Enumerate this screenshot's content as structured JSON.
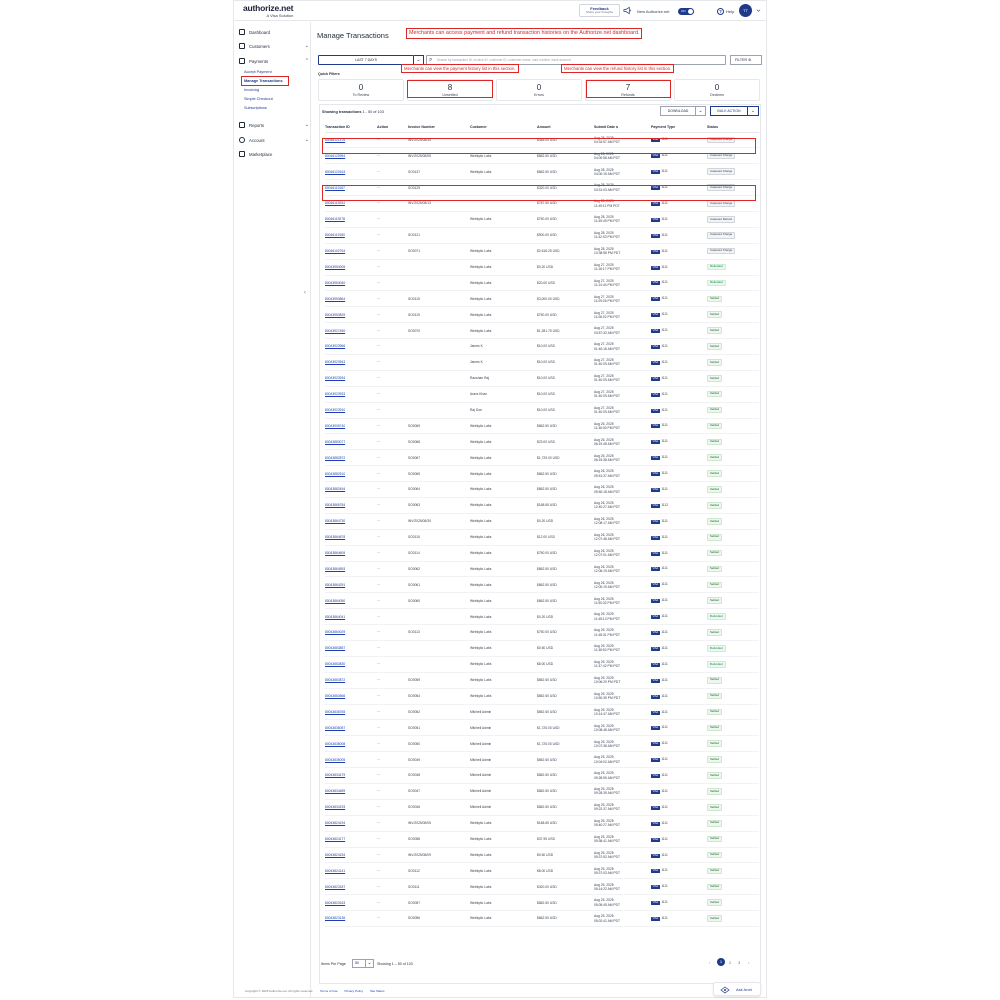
{
  "header": {
    "logo": "authorize.net",
    "logo_sub": "A Visa Solution",
    "feedback_title": "Feedback",
    "feedback_sub": "Share your thoughts",
    "new_auth_label": "New Authorize.net",
    "toggle_label": "ON",
    "help_label": "Help",
    "avatar_initials": "TT"
  },
  "sidebar": {
    "items": [
      {
        "label": "Dashboard",
        "icon": "home-icon"
      },
      {
        "label": "Customers",
        "icon": "customers-icon"
      },
      {
        "label": "Payments",
        "icon": "payments-icon"
      },
      {
        "label": "Reports",
        "icon": "reports-icon"
      },
      {
        "label": "Account",
        "icon": "gear-icon"
      },
      {
        "label": "Marketplace",
        "icon": "bag-icon"
      }
    ],
    "payments_sub": [
      "Accept Payment",
      "Manage Transactions",
      "Invoicing",
      "Simple Checkout",
      "Subscriptions"
    ]
  },
  "main": {
    "title": "Manage Transactions",
    "annotation_top": "Merchants can access payment and refund transaction histories on the Authorize.net dashboard.",
    "annotation_payment": "Merchants can view the payment history list in this section.",
    "annotation_refund": "Merchants can view the refund history list in this section.",
    "date_range": "LAST 7 DAYS",
    "search_placeholder": "Search by transaction ID, invoice ID, customer ID, customer name, card number, bank account",
    "filter_label": "FILTER",
    "quick_filters_label": "Quick Filters",
    "quick_filters": [
      {
        "count": "0",
        "label": "To Review"
      },
      {
        "count": "8",
        "label": "Unsettled"
      },
      {
        "count": "0",
        "label": "Errors"
      },
      {
        "count": "7",
        "label": "Refunds"
      },
      {
        "count": "0",
        "label": "Declines"
      }
    ],
    "showing_label": "Showing transactions",
    "showing_range": "1 - 50 of 103",
    "download_label": "DOWNLOAD",
    "bulk_action_label": "BULK ACTION"
  },
  "table": {
    "columns": [
      "Transaction ID",
      "Action",
      "Invoice Number",
      "Customer",
      "Amount",
      "Submit Date",
      "Payment Type",
      "Status"
    ],
    "rows": [
      {
        "id": "80046121476",
        "action": "···",
        "invoice": "INV/2025/08/34",
        "customer": "",
        "amount": "$448.00 USD",
        "date1": "Aug 28, 2025",
        "date2": "04:34:57 AM PDT",
        "card": "1111",
        "status": "Captured Charge"
      },
      {
        "id": "80046120954",
        "action": "···",
        "invoice": "INV/2025/08/05",
        "customer": "Webkytic Labs",
        "amount": "$862.50 USD",
        "date1": "Aug 28, 2025",
        "date2": "04:00:58 AM PDT",
        "card": "1111",
        "status": "Captured Charge"
      },
      {
        "id": "80046120163",
        "action": "···",
        "invoice": "SO0137",
        "customer": "Webkytic Labs",
        "amount": "$862.50 USD",
        "date1": "Aug 28, 2025",
        "date2": "04:00:15 AM PDT",
        "card": "1111",
        "status": "Captured Charge"
      },
      {
        "id": "80046119187",
        "action": "···",
        "invoice": "SO0129",
        "customer": "",
        "amount": "$320.00 USD",
        "date1": "Aug 28, 2025",
        "date2": "03:31:03 AM PDT",
        "card": "1111",
        "status": "Captured Charge"
      },
      {
        "id": "80046119254",
        "action": "···",
        "invoice": "INV/2025/08/13",
        "customer": "",
        "amount": "$787.50 USD",
        "date1": "Aug 28, 2025",
        "date2": "11:49:11 PM PDT",
        "card": "1111",
        "status": "Captured Charge"
      },
      {
        "id": "80046119278",
        "action": "···",
        "invoice": "",
        "customer": "Webkytic Labs",
        "amount": "$750.00 USD",
        "date1": "Aug 28, 2025",
        "date2": "11:45:49 PM PDT",
        "card": "1111",
        "status": "Captured Refund"
      },
      {
        "id": "80046119180",
        "action": "···",
        "invoice": "SO0121",
        "customer": "",
        "amount": "$900.00 USD",
        "date1": "Aug 28, 2025",
        "date2": "11:42:03 PM PDT",
        "card": "1111",
        "status": "Captured Charge"
      },
      {
        "id": "80046102764",
        "action": "···",
        "invoice": "SO0071",
        "customer": "Webkytic Labs",
        "amount": "$2,616.25 USD",
        "date1": "Aug 28, 2025",
        "date2": "10:38:58 PM PDT",
        "card": "1111",
        "status": "Captured Charge"
      },
      {
        "id": "80043954005",
        "action": "···",
        "invoice": "",
        "customer": "Webkytic Labs",
        "amount": "$0.20 USD",
        "date1": "Aug 27, 2025",
        "date2": "11:16:17 PM PDT",
        "card": "1111",
        "status": "Refunded"
      },
      {
        "id": "80043954040",
        "action": "···",
        "invoice": "",
        "customer": "Webkytic Labs",
        "amount": "$20.00 USD",
        "date1": "Aug 27, 2025",
        "date2": "11:14:44 PM PDT",
        "card": "1111",
        "status": "Refunded"
      },
      {
        "id": "80043953864",
        "action": "···",
        "invoice": "SO0115",
        "customer": "Webkytic Labs",
        "amount": "$3,000.00 USD",
        "date1": "Aug 27, 2025",
        "date2": "11:09:26 PM PDT",
        "card": "1111",
        "status": "Settled"
      },
      {
        "id": "80043953829",
        "action": "···",
        "invoice": "SO0119",
        "customer": "Webkytic Labs",
        "amount": "$750.00 USD",
        "date1": "Aug 27, 2025",
        "date2": "11:08:02 PM PDT",
        "card": "1111",
        "status": "Settled"
      },
      {
        "id": "80043927450",
        "action": "···",
        "invoice": "SO0070",
        "customer": "Webkytic Labs",
        "amount": "$1,281.75 USD",
        "date1": "Aug 27, 2025",
        "date2": "03:57:32 AM PDT",
        "card": "1111",
        "status": "Settled"
      },
      {
        "id": "80043923966",
        "action": "···",
        "invoice": "",
        "customer": "James K",
        "amount": "$10.00 USD",
        "date1": "Aug 27, 2025",
        "date2": "01:40:16 AM PDT",
        "card": "1111",
        "status": "Settled"
      },
      {
        "id": "80043923943",
        "action": "···",
        "invoice": "",
        "customer": "James K",
        "amount": "$10.00 USD",
        "date1": "Aug 27, 2025",
        "date2": "01:40:09 AM PDT",
        "card": "1111",
        "status": "Settled"
      },
      {
        "id": "80043923934",
        "action": "···",
        "invoice": "",
        "customer": "Raushan Raj",
        "amount": "$10.00 USD",
        "date1": "Aug 27, 2025",
        "date2": "01:40:09 AM PDT",
        "card": "1111",
        "status": "Settled"
      },
      {
        "id": "80043923933",
        "action": "···",
        "invoice": "",
        "customer": "Aravs Khan",
        "amount": "$10.00 USD",
        "date1": "Aug 27, 2025",
        "date2": "01:40:09 AM PDT",
        "card": "1111",
        "status": "Settled"
      },
      {
        "id": "80043923910",
        "action": "···",
        "invoice": "",
        "customer": "Raj Doe",
        "amount": "$10.00 USD",
        "date1": "Aug 27, 2025",
        "date2": "01:40:09 AM PDT",
        "card": "1111",
        "status": "Settled"
      },
      {
        "id": "80043905740",
        "action": "···",
        "invoice": "SO0069",
        "customer": "Webkytic Labs",
        "amount": "$862.50 USD",
        "date1": "Aug 26, 2025",
        "date2": "11:36:30 PM PDT",
        "card": "1111",
        "status": "Settled"
      },
      {
        "id": "80043883077",
        "action": "···",
        "invoice": "SO0068",
        "customer": "Webkytic Labs",
        "amount": "$23.00 USD",
        "date1": "Aug 26, 2025",
        "date2": "06:19:48 AM PDT",
        "card": "1111",
        "status": "Settled"
      },
      {
        "id": "80043882872",
        "action": "···",
        "invoice": "SO0067",
        "customer": "Webkytic Labs",
        "amount": "$1,725.00 USD",
        "date1": "Aug 26, 2025",
        "date2": "06:15:38 AM PDT",
        "card": "1111",
        "status": "Settled"
      },
      {
        "id": "80043882510",
        "action": "···",
        "invoice": "SO0065",
        "customer": "Webkytic Labs",
        "amount": "$862.50 USD",
        "date1": "Aug 26, 2025",
        "date2": "05:51:37 AM PDT",
        "card": "1111",
        "status": "Settled"
      },
      {
        "id": "80043882494",
        "action": "···",
        "invoice": "SO0064",
        "customer": "Webkytic Labs",
        "amount": "$862.50 USD",
        "date1": "Aug 26, 2025",
        "date2": "05:50:18 AM PDT",
        "card": "1111",
        "status": "Settled"
      },
      {
        "id": "80043865784",
        "action": "···",
        "invoice": "SO0063",
        "customer": "Webkytic Labs",
        "amount": "$168.65 USD",
        "date1": "Aug 26, 2025",
        "date2": "12:40:27 AM PDT",
        "card": "1112",
        "status": "Settled"
      },
      {
        "id": "80043864730",
        "action": "···",
        "invoice": "INV/2025/08/30",
        "customer": "Webkytic Labs",
        "amount": "$0.20 USD",
        "date1": "Aug 26, 2025",
        "date2": "12:08:17 AM PDT",
        "card": "1111",
        "status": "Settled"
      },
      {
        "id": "80043864678",
        "action": "···",
        "invoice": "SO0115",
        "customer": "Webkytic Labs",
        "amount": "$12.00 USD",
        "date1": "Aug 26, 2025",
        "date2": "12:07:48 AM PDT",
        "card": "1111",
        "status": "Settled"
      },
      {
        "id": "80043864609",
        "action": "···",
        "invoice": "SO0114",
        "customer": "Webkytic Labs",
        "amount": "$750.00 USD",
        "date1": "Aug 26, 2025",
        "date2": "12:07:01 AM PDT",
        "card": "1111",
        "status": "Settled"
      },
      {
        "id": "80043864593",
        "action": "···",
        "invoice": "SO0062",
        "customer": "Webkytic Labs",
        "amount": "$862.50 USD",
        "date1": "Aug 26, 2025",
        "date2": "12:06:19 AM PDT",
        "card": "1111",
        "status": "Settled"
      },
      {
        "id": "80043864291",
        "action": "···",
        "invoice": "SO0061",
        "customer": "Webkytic Labs",
        "amount": "$862.50 USD",
        "date1": "Aug 26, 2025",
        "date2": "12:00:19 AM PDT",
        "card": "1111",
        "status": "Settled"
      },
      {
        "id": "80043864050",
        "action": "···",
        "invoice": "SO0060",
        "customer": "Webkytic Labs",
        "amount": "$862.50 USD",
        "date1": "Aug 26, 2025",
        "date2": "11:50:32 PM PDT",
        "card": "1111",
        "status": "Settled"
      },
      {
        "id": "80043864041",
        "action": "···",
        "invoice": "",
        "customer": "Webkytic Labs",
        "amount": "$0.20 USD",
        "date1": "Aug 25, 2025",
        "date2": "11:45:13 PM PDT",
        "card": "1111",
        "status": "Refunded"
      },
      {
        "id": "80043864029",
        "action": "···",
        "invoice": "SO0113",
        "customer": "Webkytic Labs",
        "amount": "$750.00 USD",
        "date1": "Aug 25, 2025",
        "date2": "11:48:31 PM PDT",
        "card": "1111",
        "status": "Settled"
      },
      {
        "id": "80043863857",
        "action": "···",
        "invoice": "",
        "customer": "Webkytic Labs",
        "amount": "$0.50 USD",
        "date1": "Aug 25, 2025",
        "date2": "11:38:52 PM PDT",
        "card": "1111",
        "status": "Refunded"
      },
      {
        "id": "80043863830",
        "action": "···",
        "invoice": "",
        "customer": "Webkytic Labs",
        "amount": "$8.00 USD",
        "date1": "Aug 25, 2025",
        "date2": "11:37:42 PM PDT",
        "card": "1111",
        "status": "Refunded"
      },
      {
        "id": "80043863872",
        "action": "···",
        "invoice": "SO0059",
        "customer": "Webkytic Labs",
        "amount": "$862.50 USD",
        "date1": "Aug 25, 2025",
        "date2": "10:06:29 PM PDT",
        "card": "1111",
        "status": "Settled"
      },
      {
        "id": "80043863566",
        "action": "···",
        "invoice": "SO0054",
        "customer": "Webkytic Labs",
        "amount": "$862.50 USD",
        "date1": "Aug 25, 2025",
        "date2": "10:50:35 PM PDT",
        "card": "1111",
        "status": "Settled"
      },
      {
        "id": "80043836765",
        "action": "···",
        "invoice": "SO0052",
        "customer": "Mitchell Admin",
        "amount": "$862.50 USD",
        "date1": "Aug 25, 2025",
        "date2": "10:14:47 AM PDT",
        "card": "1111",
        "status": "Settled"
      },
      {
        "id": "80043836057",
        "action": "···",
        "invoice": "SO0051",
        "customer": "Mitchell Admin",
        "amount": "$1,725.00 USD",
        "date1": "Aug 25, 2025",
        "date2": "10:08:48 AM PDT",
        "card": "1111",
        "status": "Settled"
      },
      {
        "id": "80043836008",
        "action": "···",
        "invoice": "SO0050",
        "customer": "Mitchell Admin",
        "amount": "$1,725.00 USD",
        "date1": "Aug 25, 2025",
        "date2": "10:07:38 AM PDT",
        "card": "1111",
        "status": "Settled"
      },
      {
        "id": "80043836005",
        "action": "···",
        "invoice": "SO0049",
        "customer": "Mitchell Admin",
        "amount": "$862.50 USD",
        "date1": "Aug 25, 2025",
        "date2": "10:04:02 AM PDT",
        "card": "1111",
        "status": "Settled"
      },
      {
        "id": "80043834479",
        "action": "···",
        "invoice": "SO0048",
        "customer": "Mitchell Admin",
        "amount": "$862.50 USD",
        "date1": "Aug 25, 2025",
        "date2": "09:28:59 AM PDT",
        "card": "1111",
        "status": "Settled"
      },
      {
        "id": "80043834489",
        "action": "···",
        "invoice": "SO0047",
        "customer": "Mitchell Admin",
        "amount": "$862.50 USD",
        "date1": "Aug 25, 2025",
        "date2": "09:28:39 AM PDT",
        "card": "1111",
        "status": "Settled"
      },
      {
        "id": "80043834193",
        "action": "···",
        "invoice": "SO0046",
        "customer": "Mitchell Admin",
        "amount": "$862.50 USD",
        "date1": "Aug 25, 2025",
        "date2": "09:22:37 AM PDT",
        "card": "1111",
        "status": "Settled"
      },
      {
        "id": "80043824194",
        "action": "···",
        "invoice": "INV/2025/08/05",
        "customer": "Webkytic Labs",
        "amount": "$168.65 USD",
        "date1": "Aug 25, 2025",
        "date2": "05:40:27 AM PDT",
        "card": "1111",
        "status": "Settled"
      },
      {
        "id": "80043824177",
        "action": "···",
        "invoice": "SO0058",
        "customer": "Webkytic Labs",
        "amount": "$37.95 USD",
        "date1": "Aug 25, 2025",
        "date2": "05:38:41 AM PDT",
        "card": "1111",
        "status": "Settled"
      },
      {
        "id": "80043824154",
        "action": "···",
        "invoice": "INV/2025/08/09",
        "customer": "Webkytic Labs",
        "amount": "$0.50 USD",
        "date1": "Aug 25, 2025",
        "date2": "05:37:52 AM PDT",
        "card": "1111",
        "status": "Settled"
      },
      {
        "id": "80043824141",
        "action": "···",
        "invoice": "SO0112",
        "customer": "Webkytic Labs",
        "amount": "$8.00 USD",
        "date1": "Aug 25, 2025",
        "date2": "05:37:03 AM PDT",
        "card": "1111",
        "status": "Settled"
      },
      {
        "id": "80043823187",
        "action": "···",
        "invoice": "SO0111",
        "customer": "Webkytic Labs",
        "amount": "$320.00 USD",
        "date1": "Aug 25, 2025",
        "date2": "05:14:22 AM PDT",
        "card": "1111",
        "status": "Settled"
      },
      {
        "id": "80043823163",
        "action": "···",
        "invoice": "SO0057",
        "customer": "Webkytic Labs",
        "amount": "$862.50 USD",
        "date1": "Aug 25, 2025",
        "date2": "05:05:45 AM PDT",
        "card": "1111",
        "status": "Settled"
      },
      {
        "id": "80043823136",
        "action": "···",
        "invoice": "SO0056",
        "customer": "Webkytic Labs",
        "amount": "$862.50 USD",
        "date1": "Aug 25, 2025",
        "date2": "05:02:41 AM PDT",
        "card": "1111",
        "status": "Settled"
      }
    ]
  },
  "pagination": {
    "items_label": "Items Per Page",
    "items_value": "50",
    "showing": "Showing 1 – 50 of 103",
    "pages": [
      "‹",
      "1",
      "2",
      "3",
      "›"
    ]
  },
  "assistant": {
    "label": "Ask Anet"
  },
  "footer": {
    "copyright": "Copyright © 2025 Authorize.net. All rights reserved.",
    "links": [
      "Terms of Use",
      "Privacy Policy",
      "Site Status"
    ]
  },
  "colors": {
    "brand": "#1e3a8a",
    "annotation": "#dc2626",
    "link": "#1e40af"
  }
}
